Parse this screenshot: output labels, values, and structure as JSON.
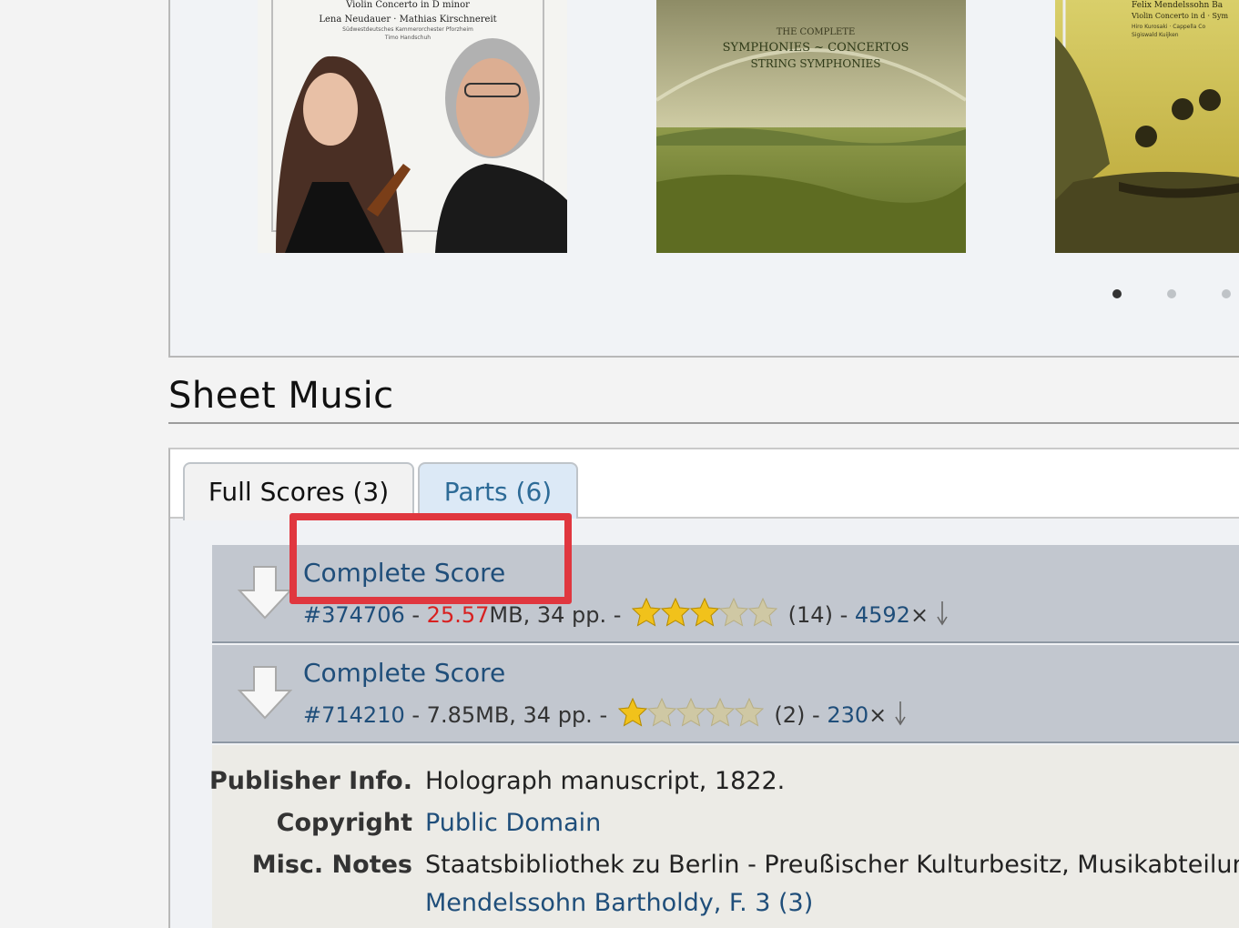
{
  "albums": [
    {
      "cover_lines": [
        "Violin Concerto in D minor",
        "Lena Neudauer · Mathias Kirschnereit",
        "Südwestdeutsches Kammerorchester Pforzheim",
        "Timo Handschuh"
      ]
    },
    {
      "cover_lines": [
        "THE COMPLETE",
        "SYMPHONIES ~ CONCERTOS",
        "STRING SYMPHONIES"
      ]
    },
    {
      "cover_lines": [
        "Felix Mendelssohn Ba",
        "Violin Concerto in d · Sym",
        "Hiro Kurosaki · Cappella Co",
        "Sigiswald Kuijken"
      ]
    }
  ],
  "carousel": {
    "dot_count": 3,
    "active_index": 0
  },
  "section_title": "Sheet Music",
  "tabs": [
    {
      "label": "Full Scores (3)",
      "active": true
    },
    {
      "label": "Parts (6)",
      "active": false
    }
  ],
  "files": [
    {
      "title": "Complete Score",
      "id": "#374706",
      "size": "25.57",
      "size_unit": "MB",
      "pages": ", 34 pp.",
      "rating": 3.3,
      "votes": "(14)",
      "downloads": "4592"
    },
    {
      "title": "Complete Score",
      "id": "#714210",
      "size": "7.85MB",
      "pages": ", 34 pp.",
      "rating": 1,
      "votes": "(2)",
      "downloads": "230"
    }
  ],
  "info": {
    "publisher_label": "Publisher Info.",
    "publisher_value": "Holograph manuscript, 1822.",
    "copyright_label": "Copyright",
    "copyright_value": "Public Domain",
    "misc_label": "Misc. Notes",
    "misc_value": "Staatsbibliothek zu Berlin - Preußischer Kulturbesitz, Musikabteilung",
    "misc_link": "Mendelssohn Bartholdy, F. 3 (3)"
  },
  "colors": {
    "link": "#1f4e7a",
    "highlight": "#e0373f",
    "size_red": "#d82020"
  }
}
